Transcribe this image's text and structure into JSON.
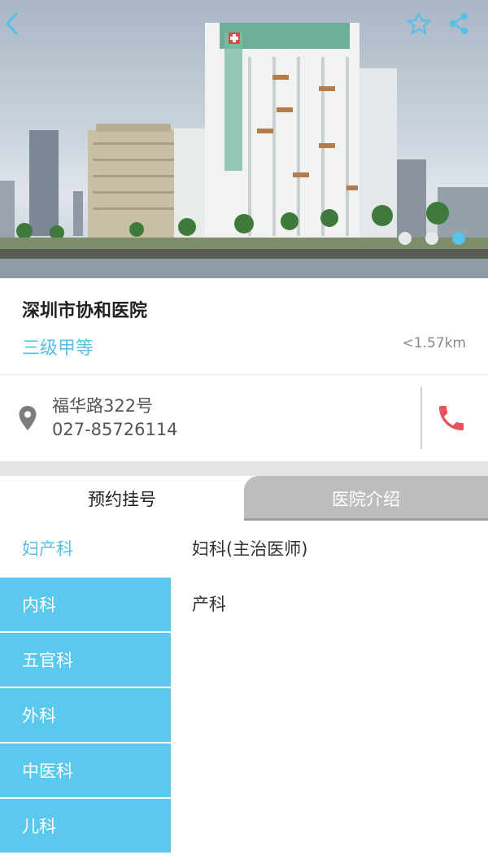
{
  "hospital": {
    "name": "深圳市协和医院",
    "level": "三级甲等",
    "distance": "<1.57km",
    "address": "福华路322号",
    "phone": "027-85726114"
  },
  "carousel": {
    "count": 3,
    "active_index": 2
  },
  "icons": {
    "back": "back-arrow-icon",
    "favorite": "star-icon",
    "share": "share-icon",
    "location": "location-pin-icon",
    "call": "phone-icon"
  },
  "tabs": [
    {
      "label": "预约挂号",
      "active": true
    },
    {
      "label": "医院介绍",
      "active": false
    }
  ],
  "departments": [
    {
      "label": "妇产科",
      "selected": true
    },
    {
      "label": "内科",
      "selected": false
    },
    {
      "label": "五官科",
      "selected": false
    },
    {
      "label": "外科",
      "selected": false
    },
    {
      "label": "中医科",
      "selected": false
    },
    {
      "label": "儿科",
      "selected": false
    }
  ],
  "sub_departments": [
    "妇科(主治医师)",
    "产科"
  ],
  "colors": {
    "accent": "#57c0e6",
    "dept_bg": "#5bc8ee",
    "call_icon": "#e8525e",
    "tab_inactive": "#bdbdbd"
  }
}
